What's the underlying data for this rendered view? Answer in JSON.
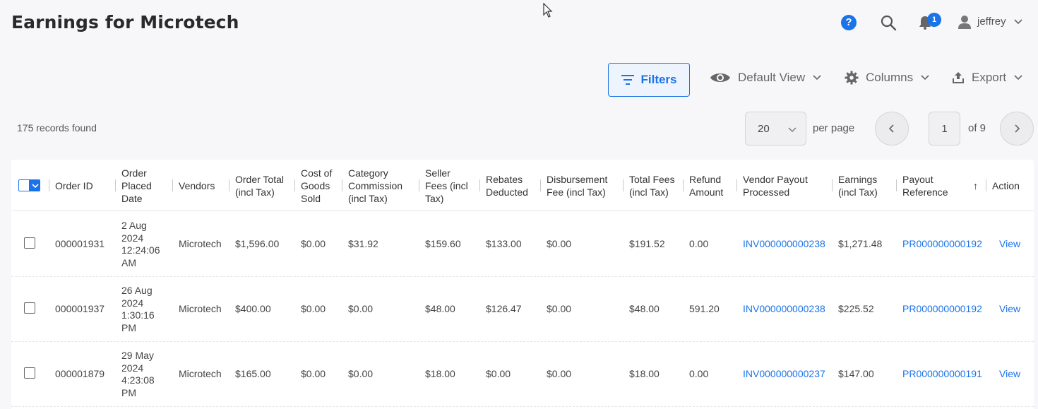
{
  "header": {
    "title": "Earnings for Microtech",
    "help_glyph": "?",
    "notification_count": "1",
    "user_name": "jeffrey"
  },
  "toolbar": {
    "filters_label": "Filters",
    "view_label": "Default View",
    "columns_label": "Columns",
    "export_label": "Export"
  },
  "pagination": {
    "records_text": "175 records found",
    "per_page_value": "20",
    "per_page_label": "per page",
    "current_page": "1",
    "total_pages_text": "of 9"
  },
  "table": {
    "columns": [
      "Order ID",
      "Order Placed Date",
      "Vendors",
      "Order Total (incl Tax)",
      "Cost of Goods Sold",
      "Category Commission (incl Tax)",
      "Seller Fees (incl Tax)",
      "Rebates Deducted",
      "Disbursement Fee (incl Tax)",
      "Total Fees (incl Tax)",
      "Refund Amount",
      "Vendor Payout Processed",
      "Earnings (incl Tax)",
      "Payout Reference",
      "Action"
    ],
    "sort_arrow": "↑",
    "rows": [
      [
        "000001931",
        "2 Aug 2024 12:24:06 AM",
        "Microtech",
        "$1,596.00",
        "$0.00",
        "$31.92",
        "$159.60",
        "$133.00",
        "$0.00",
        "$191.52",
        "0.00",
        "INV000000000238",
        "$1,271.48",
        "PR000000000192",
        "View"
      ],
      [
        "000001937",
        "26 Aug 2024 1:30:16 PM",
        "Microtech",
        "$400.00",
        "$0.00",
        "$0.00",
        "$48.00",
        "$126.47",
        "$0.00",
        "$48.00",
        "591.20",
        "INV000000000238",
        "$225.52",
        "PR000000000192",
        "View"
      ],
      [
        "000001879",
        "29 May 2024 4:23:08 PM",
        "Microtech",
        "$165.00",
        "$0.00",
        "$0.00",
        "$18.00",
        "$0.00",
        "$0.00",
        "$18.00",
        "0.00",
        "INV000000000237",
        "$147.00",
        "PR000000000191",
        "View"
      ]
    ]
  },
  "colors": {
    "accent": "#1a73e8",
    "background": "#f7f7f9"
  }
}
